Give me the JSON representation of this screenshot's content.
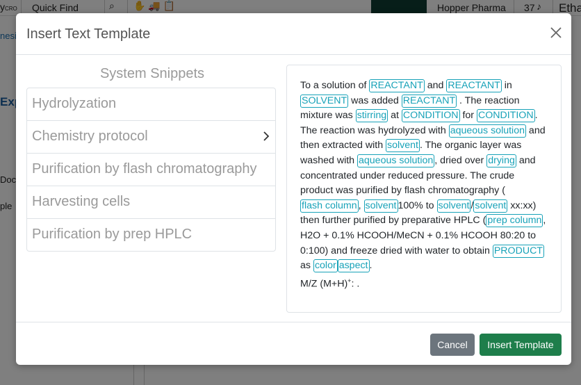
{
  "background": {
    "brand_partial": "y",
    "brand_sub": "CRO",
    "quick_find": "Quick Find",
    "org_name": "Hopper Pharma",
    "notification_count": "37",
    "user_partial": "Etha",
    "left_partial_1": "nesis",
    "left_partial_2": "Exp",
    "left_partial_3": "Doc",
    "left_partial_4": "ple"
  },
  "modal": {
    "title": "Insert Text Template",
    "snippets_title": "System Snippets",
    "snippets": [
      {
        "label": "Hydrolyzation"
      },
      {
        "label": "Chemistry protocol"
      },
      {
        "label": "Purification by flash chromatography"
      },
      {
        "label": "Harvesting cells"
      },
      {
        "label": "Purification by prep HPLC"
      }
    ],
    "active_snippet": "Chemistry protocol",
    "template": {
      "t1": "To a solution of ",
      "p_reactant1": "REACTANT",
      "t2": " and ",
      "p_reactant2": "REACTANT",
      "t3": " in ",
      "p_solvent1": "SOLVENT",
      "t4": " was added ",
      "p_reactant3": "REACTANT",
      "t5": " . The reaction mixture was ",
      "p_stirring": "stirring",
      "t6": " at ",
      "p_condition1": "CONDITION",
      "t7": " for ",
      "p_condition2": "CONDITION",
      "t8": ". The reaction was hydrolyzed with ",
      "p_aqueous1": "aqueous solution",
      "t9": " and then extracted with ",
      "p_solvent2": "solvent",
      "t10": ". The organic layer was washed with ",
      "p_aqueous2": "aqueous solution",
      "t11": ", dried over ",
      "p_drying": "drying",
      "t12": " and concentrated under reduced pressure. The crude product was purified by flash chromatography (",
      "p_flash": "flash column",
      "t13": ", ",
      "p_solvent3": "solvent",
      "t14": "100% to ",
      "p_solvent4": "solvent",
      "t15": "/",
      "p_solvent5": "solvent",
      "t16": " xx:xx) then further purified by preparative HPLC (",
      "p_prep": "prep column",
      "t17": ", H2O + 0.1% HCOOH/MeCN + 0.1% HCOOH 80:20 to 0:100) and freeze dried with water to obtain ",
      "p_product": "PRODUCT",
      "t18": " as ",
      "p_color": "color",
      "p_aspect": "aspect",
      "t19": ".",
      "t20": "M/Z (M+H)",
      "t21": "+",
      "t22": ": ."
    },
    "cancel_label": "Cancel",
    "insert_label": "Insert Template"
  }
}
